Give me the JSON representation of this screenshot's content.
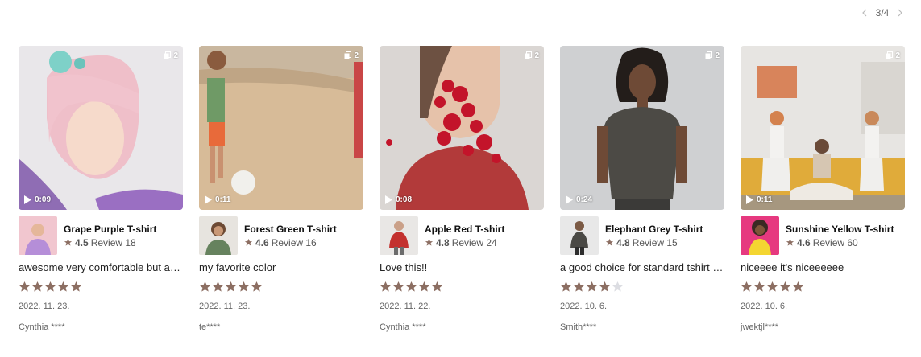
{
  "pager": {
    "label": "3/4",
    "prev_icon": "chevron-left-icon",
    "next_icon": "chevron-right-icon"
  },
  "colors": {
    "star_filled": "#8c6e62",
    "star_empty": "#dcdde2",
    "text_muted": "#666666"
  },
  "cards": [
    {
      "media_count": "2",
      "duration": "0:09",
      "product": {
        "name": "Grape Purple T-shirt",
        "rating": "4.5",
        "review_label": "Review 18"
      },
      "review_text": "awesome very comfortable but a…",
      "stars": 5,
      "date": "2022. 11. 23.",
      "author": "Cynthia ****"
    },
    {
      "media_count": "2",
      "duration": "0:11",
      "product": {
        "name": "Forest Green T-shirt",
        "rating": "4.6",
        "review_label": "Review 16"
      },
      "review_text": "my favorite color",
      "stars": 5,
      "date": "2022. 11. 23.",
      "author": "te****"
    },
    {
      "media_count": "2",
      "duration": "0:08",
      "product": {
        "name": "Apple Red T-shirt",
        "rating": "4.8",
        "review_label": "Review 24"
      },
      "review_text": "Love this!!",
      "stars": 5,
      "date": "2022. 11. 22.",
      "author": "Cynthia ****"
    },
    {
      "media_count": "2",
      "duration": "0:24",
      "product": {
        "name": "Elephant Grey T-shirt",
        "rating": "4.8",
        "review_label": "Review 15"
      },
      "review_text": "a good choice for standard tshirt …",
      "stars": 4,
      "date": "2022. 10. 6.",
      "author": "Smith****"
    },
    {
      "media_count": "2",
      "duration": "0:11",
      "product": {
        "name": "Sunshine Yellow T-shirt",
        "rating": "4.6",
        "review_label": "Review 60"
      },
      "review_text": "niceeee it's niceeeeee",
      "stars": 5,
      "date": "2022. 10. 6.",
      "author": "jwektjl****"
    }
  ]
}
